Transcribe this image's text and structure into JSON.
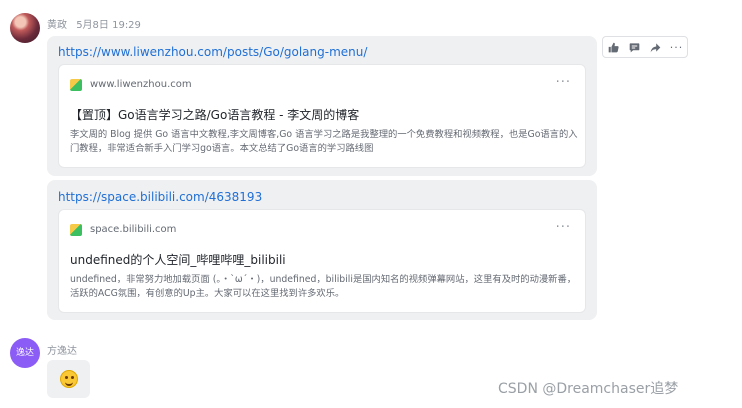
{
  "message1": {
    "sender": "黄政",
    "time": "5月8日 19:29",
    "link1": {
      "url": "https://www.liwenzhou.com/posts/Go/golang-menu/",
      "site": "www.liwenzhou.com",
      "title": "【置顶】Go语言学习之路/Go语言教程 - 李文周的博客",
      "description": "李文周的 Blog 提供 Go 语言中文教程,李文周博客,Go 语言学习之路是我整理的一个免费教程和视频教程，也是Go语言的入门教程，非常适合新手入门学习go语言。本文总结了Go语言的学习路线图",
      "more": "···"
    },
    "link2": {
      "url": "https://space.bilibili.com/4638193",
      "site": "space.bilibili.com",
      "title": "undefined的个人空间_哔哩哔哩_bilibili",
      "description": "undefined，非常努力地加载页面 (。・`ω´・)，undefined，bilibili是国内知名的视频弹幕网站，这里有及时的动漫新番，活跃的ACG氛围，有创意的Up主。大家可以在这里找到许多欢乐。",
      "more": "···"
    }
  },
  "toolbar": {
    "icons": [
      "thumbs-up-icon",
      "comment-icon",
      "forward-icon",
      "more-icon"
    ],
    "more": "···"
  },
  "message2": {
    "sender": "方逸达",
    "avatar_text": "逸达",
    "avatar_color": "#8b5cf6",
    "emoji": "smiley-emoji"
  },
  "watermark": "CSDN @Dreamchaser追梦",
  "colors": {
    "link": "#1f6fd6",
    "bubble": "#eff0f1"
  }
}
